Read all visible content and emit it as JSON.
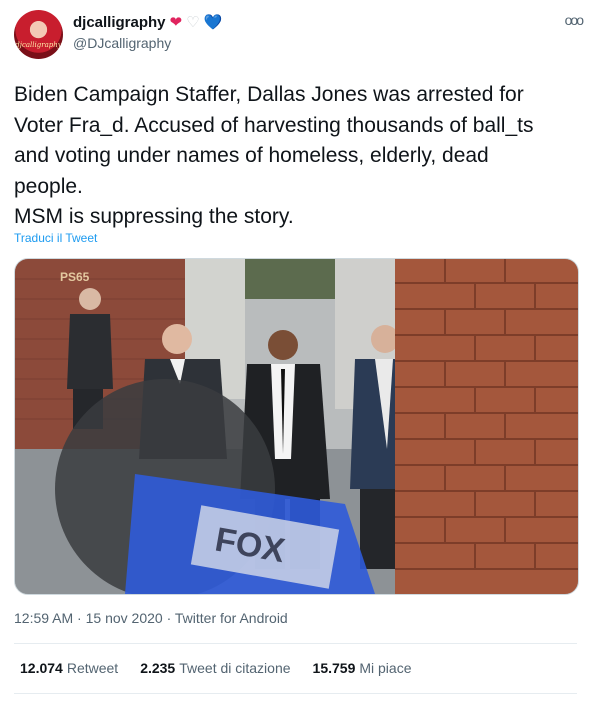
{
  "user": {
    "display_name": "djcalligraphy",
    "handle": "@DJcalligraphy",
    "avatar_text": "djcalligraphy",
    "hearts": [
      "❤",
      "♡",
      "💙"
    ]
  },
  "more_icon": "ooo",
  "tweet": {
    "lines": [
      "Biden Campaign Staffer, Dallas Jones was arrested for",
      "Voter Fra_d. Accused of harvesting thousands of ball_ts",
      "and voting under names of homeless, elderly, dead",
      "people.",
      "MSM is suppressing the story."
    ],
    "translate_label": "Traduci il Tweet"
  },
  "media": {
    "sign_text": "PS65",
    "mic_text": "FOX"
  },
  "meta": {
    "time": "12:59 AM",
    "separator": " · ",
    "date": "15 nov 2020",
    "source": "Twitter for Android"
  },
  "stats": {
    "retweets_count": "12.074",
    "retweets_label": "Retweet",
    "quotes_count": "2.235",
    "quotes_label": "Tweet di citazione",
    "likes_count": "15.759",
    "likes_label": "Mi piace"
  },
  "colors": {
    "accent": "#1d9bf0",
    "secondary_text": "#536471",
    "heart_red": "#e0245e",
    "heart_blue": "#4a90e2"
  }
}
